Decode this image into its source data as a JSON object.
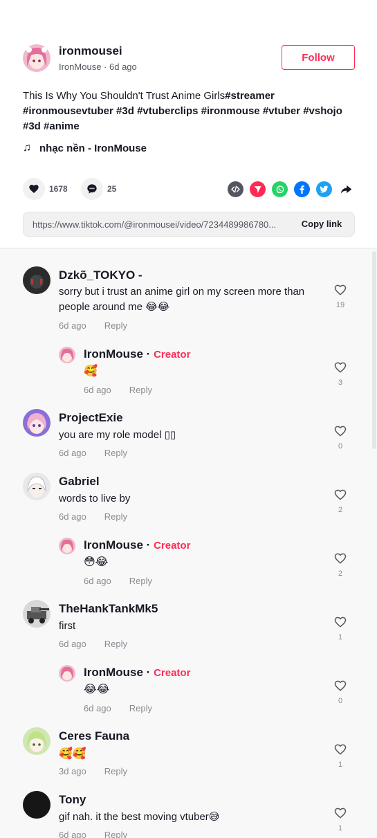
{
  "post": {
    "author_username": "ironmousei",
    "author_display": "IronMouse",
    "author_time": "6d ago",
    "follow_label": "Follow",
    "caption_text": "This Is Why You Shouldn't Trust Anime Girls",
    "hashtags": [
      "#streamer",
      "#ironmousevtuber",
      "#3d",
      "#vtuberclips",
      "#ironmouse",
      "#vtuber",
      "#vshojo",
      "#3d",
      "#anime"
    ],
    "music": "nhạc nền - IronMouse",
    "likes": "1678",
    "comments_count": "25",
    "link_url": "https://www.tiktok.com/@ironmousei/video/7234489986780...",
    "copy_link_label": "Copy link"
  },
  "share_icons": [
    {
      "name": "embed-icon",
      "color": "#545661"
    },
    {
      "name": "send-to-friends-icon",
      "color": "#fe2c55"
    },
    {
      "name": "whatsapp-icon",
      "color": "#25d366"
    },
    {
      "name": "facebook-icon",
      "color": "#0075fa"
    },
    {
      "name": "twitter-icon",
      "color": "#1da1f2"
    },
    {
      "name": "share-arrow-icon",
      "color": "#161823"
    }
  ],
  "comments": [
    {
      "user": "Dzkõ_TOKYO -",
      "text": "sorry but i trust an anime girl on my screen more than people around me 😂😂",
      "time": "6d ago",
      "reply_label": "Reply",
      "likes": "19"
    },
    {
      "user": "IronMouse",
      "creator": "Creator",
      "text": "🥰",
      "time": "6d ago",
      "reply_label": "Reply",
      "likes": "3"
    },
    {
      "user": "ProjectExie",
      "text": "you are my role model ▯▯",
      "time": "6d ago",
      "reply_label": "Reply",
      "likes": "0"
    },
    {
      "user": "Gabriel",
      "text": "words to live by",
      "time": "6d ago",
      "reply_label": "Reply",
      "likes": "2"
    },
    {
      "user": "IronMouse",
      "creator": "Creator",
      "text": "😳😂",
      "time": "6d ago",
      "reply_label": "Reply",
      "likes": "2"
    },
    {
      "user": "TheHankTankMk5",
      "text": "first",
      "time": "6d ago",
      "reply_label": "Reply",
      "likes": "1"
    },
    {
      "user": "IronMouse",
      "creator": "Creator",
      "text": "😂😂",
      "time": "6d ago",
      "reply_label": "Reply",
      "likes": "0"
    },
    {
      "user": "Ceres Fauna",
      "text": "🥰🥰",
      "time": "3d ago",
      "reply_label": "Reply",
      "likes": "1"
    },
    {
      "user": "Tony",
      "text": "gif nah. it the best moving vtuber😅",
      "time": "6d ago",
      "reply_label": "Reply",
      "likes": "1"
    }
  ]
}
